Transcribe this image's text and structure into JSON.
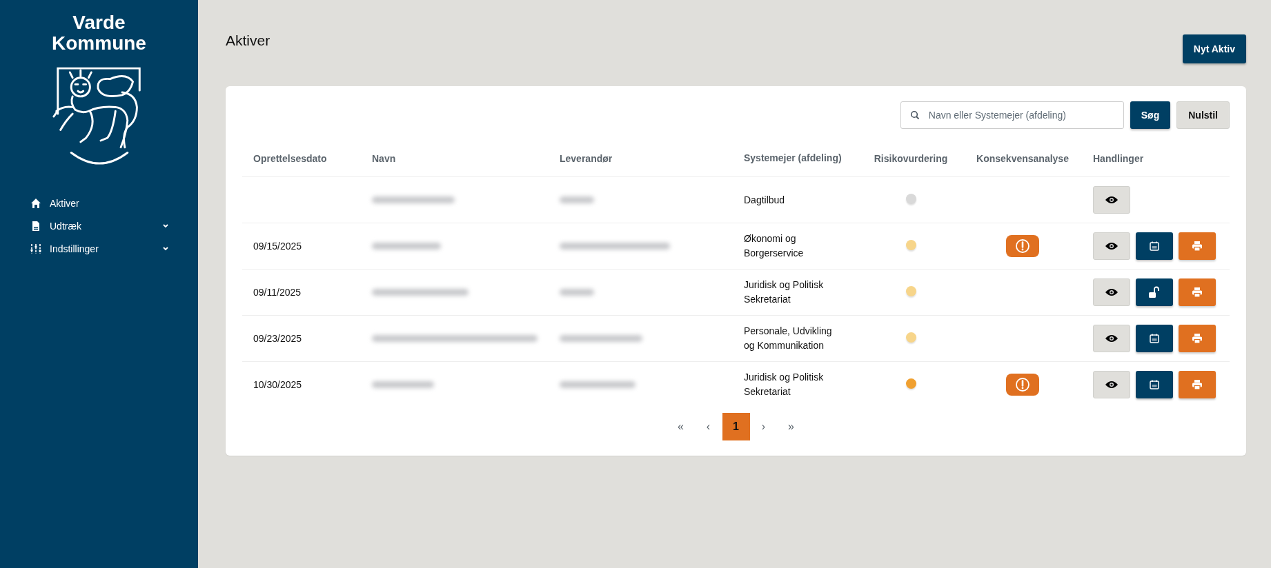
{
  "sidebar": {
    "logo_lines": [
      "Varde",
      "Kommune"
    ],
    "items": [
      {
        "label": "Aktiver",
        "kind": "home",
        "expandable": false
      },
      {
        "label": "Udtræk",
        "kind": "document",
        "expandable": true
      },
      {
        "label": "Indstillinger",
        "kind": "sliders",
        "expandable": true
      }
    ]
  },
  "page": {
    "title": "Aktiver",
    "new_button": "Nyt Aktiv"
  },
  "search": {
    "placeholder": "Navn eller Systemejer (afdeling)",
    "search_button": "Søg",
    "reset_button": "Nulstil"
  },
  "table": {
    "columns": [
      "Oprettelsesdato",
      "Navn",
      "Leverandør",
      "Systemejer (afdeling)",
      "Risikovurdering",
      "Konsekvensanalyse",
      "Handlinger"
    ],
    "rows": [
      {
        "date": "",
        "owner": "Dagtilbud",
        "color": "#d9d9d9",
        "warning": false,
        "actions": [
          {
            "kind": "view"
          }
        ]
      },
      {
        "date": "09/15/2025",
        "owner": "Økonomi og Borgerservice",
        "color": "#f7d58a",
        "warning": true,
        "actions": [
          {
            "kind": "view"
          },
          {
            "kind": "calendar"
          },
          {
            "kind": "print"
          }
        ]
      },
      {
        "date": "09/11/2025",
        "owner": "Juridisk og Politisk Sekretariat",
        "color": "#f7d58a",
        "warning": false,
        "actions": [
          {
            "kind": "view"
          },
          {
            "kind": "unlock"
          },
          {
            "kind": "print"
          }
        ]
      },
      {
        "date": "09/23/2025",
        "owner": "Personale, Udvikling og Kommunikation",
        "color": "#f7d58a",
        "warning": false,
        "actions": [
          {
            "kind": "view"
          },
          {
            "kind": "calendar"
          },
          {
            "kind": "print"
          }
        ]
      },
      {
        "date": "10/30/2025",
        "owner": "Juridisk og Politisk Sekretariat",
        "color": "#f0a030",
        "warning": true,
        "actions": [
          {
            "kind": "view"
          },
          {
            "kind": "calendar"
          },
          {
            "kind": "print"
          }
        ]
      }
    ]
  },
  "pagination": [
    {
      "label": "«",
      "selected": false
    },
    {
      "label": "‹",
      "selected": false
    },
    {
      "label": "1",
      "selected": true
    },
    {
      "label": "›",
      "selected": false
    },
    {
      "label": "»",
      "selected": false
    }
  ]
}
